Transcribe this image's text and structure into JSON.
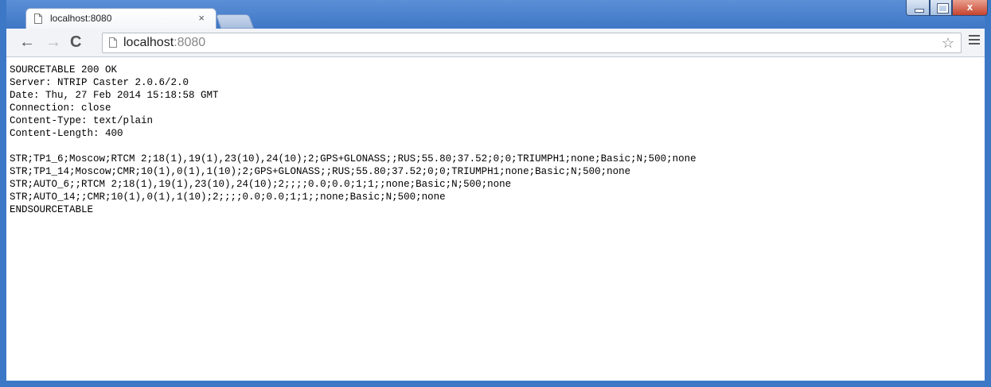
{
  "tab": {
    "title": "localhost:8080",
    "close": "×"
  },
  "toolbar": {
    "back": "←",
    "forward": "→",
    "reload": "C",
    "url_host": "localhost",
    "url_port": ":8080",
    "star": "☆"
  },
  "window": {
    "close_glyph": "x"
  },
  "content": {
    "lines": [
      "SOURCETABLE 200 OK",
      "Server: NTRIP Caster 2.0.6/2.0",
      "Date: Thu, 27 Feb 2014 15:18:58 GMT",
      "Connection: close",
      "Content-Type: text/plain",
      "Content-Length: 400",
      "",
      "STR;TP1_6;Moscow;RTCM 2;18(1),19(1),23(10),24(10);2;GPS+GLONASS;;RUS;55.80;37.52;0;0;TRIUMPH1;none;Basic;N;500;none",
      "STR;TP1_14;Moscow;CMR;10(1),0(1),1(10);2;GPS+GLONASS;;RUS;55.80;37.52;0;0;TRIUMPH1;none;Basic;N;500;none",
      "STR;AUTO_6;;RTCM 2;18(1),19(1),23(10),24(10);2;;;;0.0;0.0;1;1;;none;Basic;N;500;none",
      "STR;AUTO_14;;CMR;10(1),0(1),1(10);2;;;;0.0;0.0;1;1;;none;Basic;N;500;none",
      "ENDSOURCETABLE"
    ]
  }
}
